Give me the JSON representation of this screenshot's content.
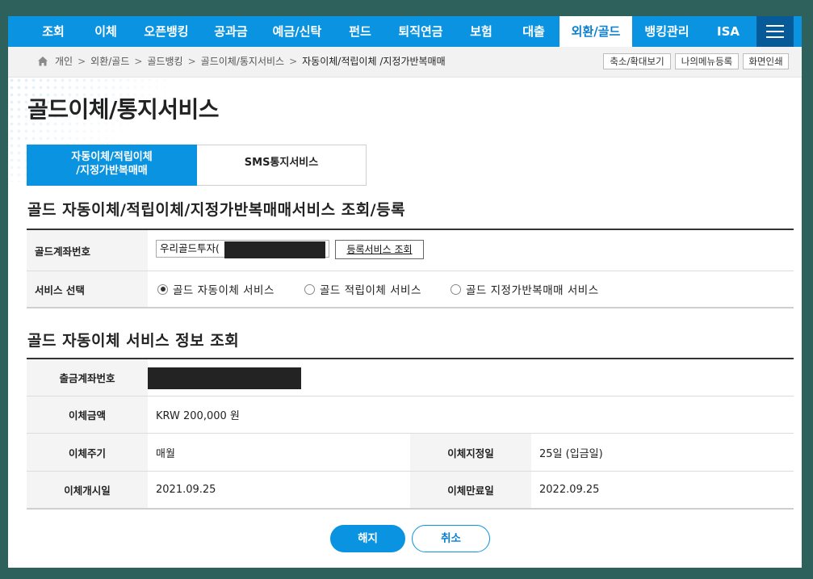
{
  "top_nav": {
    "items": [
      {
        "label": "조회",
        "active": false
      },
      {
        "label": "이체",
        "active": false
      },
      {
        "label": "오픈뱅킹",
        "active": false
      },
      {
        "label": "공과금",
        "active": false
      },
      {
        "label": "예금/신탁",
        "active": false
      },
      {
        "label": "펀드",
        "active": false
      },
      {
        "label": "퇴직연금",
        "active": false
      },
      {
        "label": "보험",
        "active": false
      },
      {
        "label": "대출",
        "active": false
      },
      {
        "label": "외환/골드",
        "active": true
      },
      {
        "label": "뱅킹관리",
        "active": false
      },
      {
        "label": "ISA",
        "active": false
      }
    ],
    "menu_icon": "hamburger-icon"
  },
  "breadcrumb": {
    "home_icon": "home-icon",
    "items": [
      "개인",
      "외환/골드",
      "골드뱅킹",
      "골드이체/통지서비스",
      "자동이체/적립이체 /지정가반복매매"
    ],
    "separator": ">",
    "buttons": [
      "축소/확대보기",
      "나의메뉴등록",
      "화면인쇄"
    ]
  },
  "page_title": "골드이체/통지서비스",
  "tabs": [
    {
      "line1": "자동이체/적립이체",
      "line2": "/지정가반복매매",
      "active": true
    },
    {
      "label": "SMS통지서비스",
      "active": false
    }
  ],
  "section1": {
    "title": "골드 자동이체/적립이체/지정가반복매매서비스 조회/등록",
    "account_label": "골드계좌번호",
    "account_value": "우리골드투자(",
    "query_button": "등록서비스 조회",
    "service_label": "서비스 선택",
    "services": [
      {
        "label": "골드 자동이체 서비스",
        "selected": true
      },
      {
        "label": "골드 적립이체 서비스",
        "selected": false
      },
      {
        "label": "골드 지정가반복매매 서비스",
        "selected": false
      }
    ]
  },
  "section2": {
    "title": "골드 자동이체 서비스 정보 조회",
    "withdraw_label": "출금계좌번호",
    "amount_label": "이체금액",
    "amount_value": "KRW 200,000 원",
    "cycle_label": "이체주기",
    "cycle_value": "매월",
    "designated_day_label": "이체지정일",
    "designated_day_value": "25일 (입금일)",
    "start_label": "이체개시일",
    "start_value": "2021.09.25",
    "end_label": "이체만료일",
    "end_value": "2022.09.25"
  },
  "buttons": {
    "terminate": "해지",
    "cancel": "취소"
  },
  "colors": {
    "nav_blue": "#0a93e0",
    "nav_dark": "#075a98",
    "outer_bg": "#2f615c"
  }
}
